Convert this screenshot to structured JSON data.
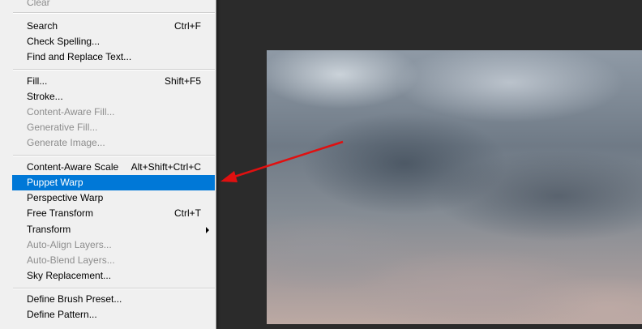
{
  "menu": {
    "items": [
      {
        "label": "Clear",
        "shortcut": "",
        "disabled": true
      },
      {
        "label": "Search",
        "shortcut": "Ctrl+F"
      },
      {
        "label": "Check Spelling...",
        "shortcut": ""
      },
      {
        "label": "Find and Replace Text...",
        "shortcut": ""
      },
      {
        "label": "Fill...",
        "shortcut": "Shift+F5"
      },
      {
        "label": "Stroke...",
        "shortcut": ""
      },
      {
        "label": "Content-Aware Fill...",
        "shortcut": "",
        "disabled": true
      },
      {
        "label": "Generative Fill...",
        "shortcut": "",
        "disabled": true
      },
      {
        "label": "Generate Image...",
        "shortcut": "",
        "disabled": true
      },
      {
        "label": "Content-Aware Scale",
        "shortcut": "Alt+Shift+Ctrl+C"
      },
      {
        "label": "Puppet Warp",
        "shortcut": "",
        "selected": true
      },
      {
        "label": "Perspective Warp",
        "shortcut": ""
      },
      {
        "label": "Free Transform",
        "shortcut": "Ctrl+T"
      },
      {
        "label": "Transform",
        "shortcut": "",
        "submenu": true
      },
      {
        "label": "Auto-Align Layers...",
        "shortcut": "",
        "disabled": true
      },
      {
        "label": "Auto-Blend Layers...",
        "shortcut": "",
        "disabled": true
      },
      {
        "label": "Sky Replacement...",
        "shortcut": ""
      },
      {
        "label": "Define Brush Preset...",
        "shortcut": ""
      },
      {
        "label": "Define Pattern...",
        "shortcut": ""
      }
    ]
  },
  "colors": {
    "menu_background": "#f0f0f0",
    "selection": "#0078d7",
    "disabled_text": "#8d8d8d",
    "workspace": "#2b2b2b",
    "annotation_arrow": "#e01010"
  },
  "icons": {
    "submenu": "chevron-right-icon",
    "annotation": "red-arrow-icon"
  }
}
